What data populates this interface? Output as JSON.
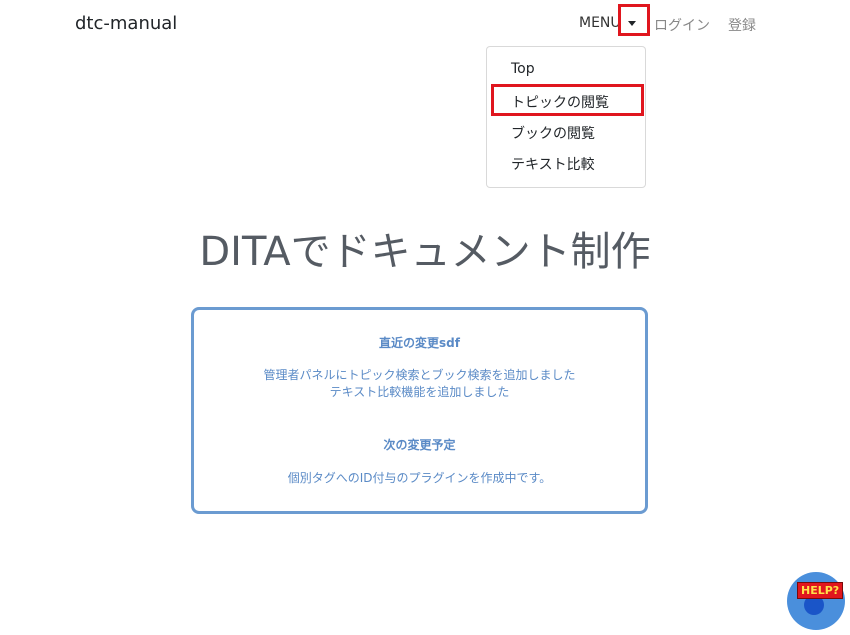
{
  "brand": "dtc-manual",
  "nav": {
    "menu_label": "MENU",
    "login_label": "ログイン",
    "register_label": "登録"
  },
  "dropdown": {
    "items": [
      "Top",
      "トピックの閲覧",
      "ブックの閲覧",
      "テキスト比較"
    ]
  },
  "hero": {
    "title": "DITAでドキュメント制作"
  },
  "news": {
    "recent_heading": "直近の変更sdf",
    "recent_lines": [
      "管理者パネルにトピック検索とブック検索を追加しました",
      "テキスト比較機能を追加しました"
    ],
    "planned_heading": "次の変更予定",
    "planned_lines": [
      "個別タグへのID付与のプラグインを作成中です。"
    ]
  },
  "help": {
    "label": "HELP?"
  },
  "colors": {
    "highlight": "#e0161e",
    "news_border": "#6b9bd1",
    "news_text": "#5a8ac6",
    "help_bubble": "#4a8fdc"
  },
  "icons": {
    "dropdown_toggle": "caret-down-icon"
  }
}
